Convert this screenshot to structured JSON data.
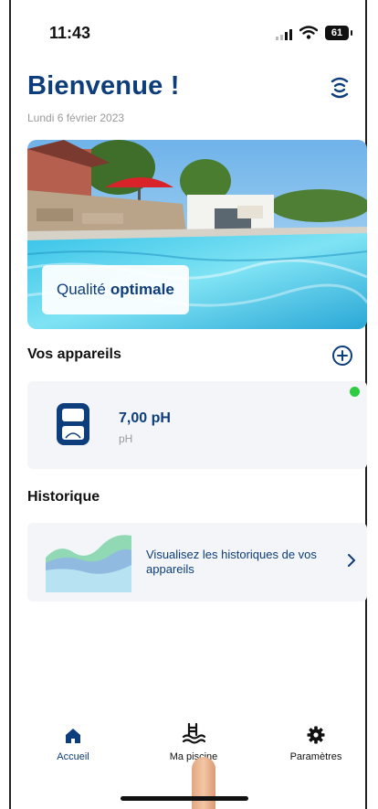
{
  "status_bar": {
    "time": "11:43",
    "battery": "61"
  },
  "header": {
    "title": "Bienvenue !",
    "date": "Lundi 6 février 2023"
  },
  "hero": {
    "quality_prefix": "Qualité",
    "quality_value": "optimale"
  },
  "devices": {
    "title": "Vos appareils",
    "items": [
      {
        "value": "7,00 pH",
        "unit": "pH",
        "status_color": "#2ecc40"
      }
    ]
  },
  "history": {
    "title": "Historique",
    "card_text": "Visualisez les historiques de vos appareils"
  },
  "nav": {
    "items": [
      {
        "label": "Accueil",
        "icon": "home-icon",
        "active": true
      },
      {
        "label": "Ma piscine",
        "icon": "pool-icon",
        "active": false
      },
      {
        "label": "Paramètres",
        "icon": "gear-icon",
        "active": false
      }
    ]
  },
  "colors": {
    "brand": "#0d3d7a",
    "background": "#ffffff",
    "card": "#f3f5f8",
    "online": "#2ecc40"
  }
}
